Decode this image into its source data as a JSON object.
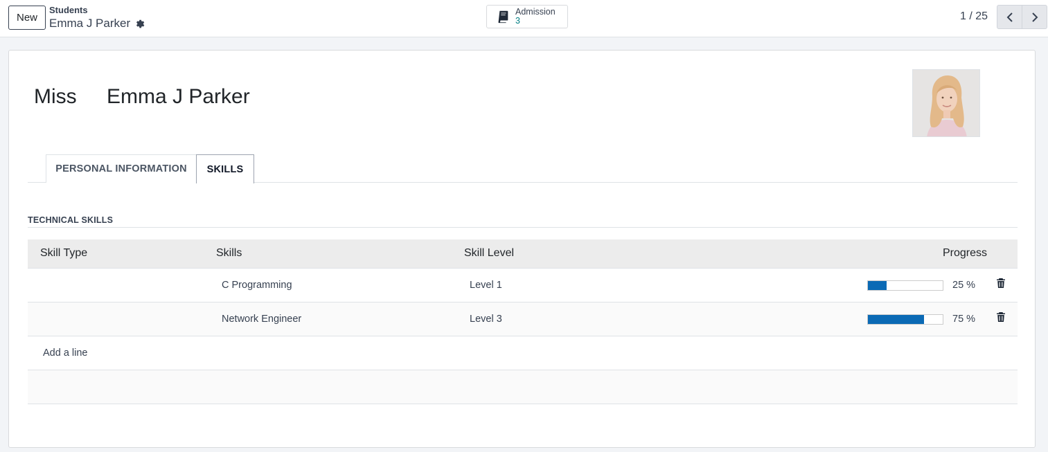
{
  "control_panel": {
    "new_label": "New",
    "breadcrumb_parent": "Students",
    "breadcrumb_current": "Emma J Parker",
    "smart_button": {
      "label": "Admission",
      "value": "3"
    },
    "pager": "1 / 25"
  },
  "record": {
    "prefix": "Miss",
    "name": "Emma J Parker"
  },
  "tabs": [
    {
      "label": "PERSONAL INFORMATION",
      "active": false
    },
    {
      "label": "SKILLS",
      "active": true
    }
  ],
  "skills_section": {
    "title": "TECHNICAL SKILLS",
    "columns": [
      "Skill Type",
      "Skills",
      "Skill Level",
      "Progress"
    ],
    "rows": [
      {
        "skill_type": "",
        "skill": "C Programming",
        "level": "Level 1",
        "progress": 25,
        "progress_label": "25 %"
      },
      {
        "skill_type": "",
        "skill": "Network Engineer",
        "level": "Level 3",
        "progress": 75,
        "progress_label": "75 %"
      }
    ],
    "add_line": "Add a line"
  },
  "colors": {
    "progress_fill": "#0b6ab5",
    "link_accent": "#017e84"
  },
  "icons": [
    "gear-icon",
    "book-icon",
    "chevron-left-icon",
    "chevron-right-icon",
    "trash-icon"
  ]
}
